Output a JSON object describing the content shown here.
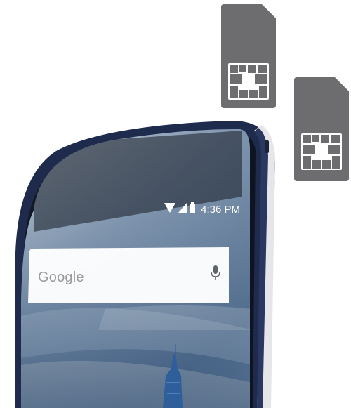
{
  "status_bar": {
    "time": "4:36 PM",
    "icons": [
      "wifi-icon",
      "signal-icon",
      "battery-icon"
    ]
  },
  "search_widget": {
    "brand_text": "Google",
    "icon": "microphone-icon"
  },
  "sim_cards": [
    "sim-card-icon",
    "sim-card-icon"
  ],
  "colors": {
    "phone_body": "#1e2b4d",
    "sim_card": "#6d6d6f",
    "search_bar": "#ffffff"
  }
}
